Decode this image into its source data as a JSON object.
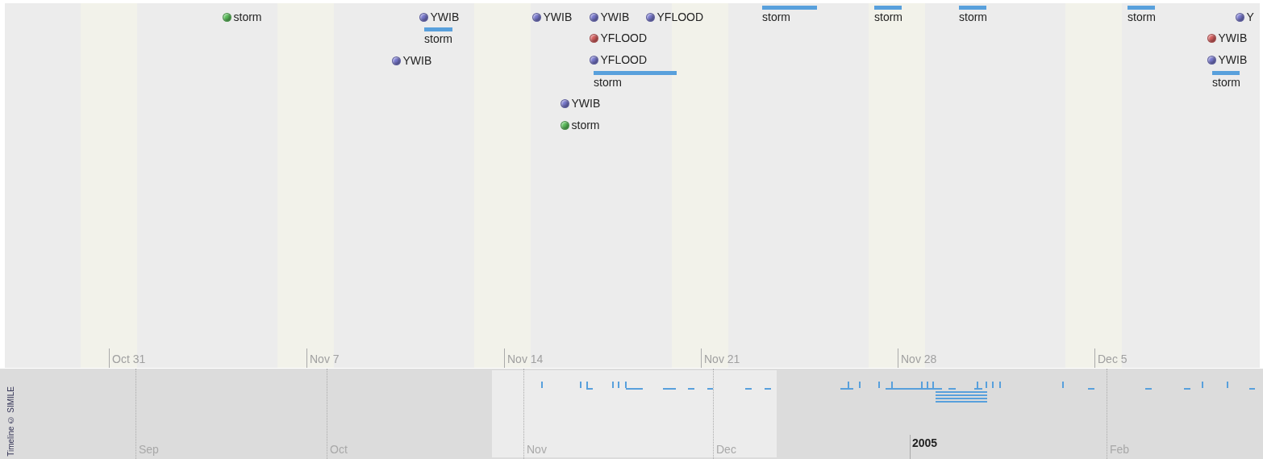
{
  "detail_band": {
    "events": [
      {
        "kind": "point",
        "label": "storm",
        "color": "#5cc05c"
      },
      {
        "kind": "point",
        "label": "YWIB",
        "color": "#7a7ad0"
      },
      {
        "kind": "duration",
        "label": "storm"
      },
      {
        "kind": "point",
        "label": "YWIB",
        "color": "#7a7ad0"
      },
      {
        "kind": "point",
        "label": "YWIB",
        "color": "#7a7ad0"
      },
      {
        "kind": "point",
        "label": "YWIB",
        "color": "#7a7ad0"
      },
      {
        "kind": "point",
        "label": "YFLOOD",
        "color": "#7a7ad0"
      },
      {
        "kind": "point",
        "label": "YFLOOD",
        "color": "#d86060"
      },
      {
        "kind": "point",
        "label": "YFLOOD",
        "color": "#7a7ad0"
      },
      {
        "kind": "duration",
        "label": "storm"
      },
      {
        "kind": "point",
        "label": "YWIB",
        "color": "#7a7ad0"
      },
      {
        "kind": "point",
        "label": "storm",
        "color": "#5cc05c"
      },
      {
        "kind": "duration",
        "label": "storm"
      },
      {
        "kind": "duration",
        "label": "storm"
      },
      {
        "kind": "duration",
        "label": "storm"
      },
      {
        "kind": "duration",
        "label": "storm"
      },
      {
        "kind": "point",
        "label": "Y",
        "color": "#7a7ad0"
      },
      {
        "kind": "point",
        "label": "YWIB",
        "color": "#d86060"
      },
      {
        "kind": "point",
        "label": "YWIB",
        "color": "#7a7ad0"
      },
      {
        "kind": "duration",
        "label": "storm"
      }
    ],
    "date_labels": [
      "Oct 31",
      "Nov 7",
      "Nov 14",
      "Nov 21",
      "Nov 28",
      "Dec 5"
    ]
  },
  "overview_band": {
    "credit": "Timeline © SIMILE",
    "labels": [
      {
        "kind": "month",
        "text": "Sep"
      },
      {
        "kind": "month",
        "text": "Oct"
      },
      {
        "kind": "month",
        "text": "Nov"
      },
      {
        "kind": "month",
        "text": "Dec"
      },
      {
        "kind": "year",
        "text": "2005"
      },
      {
        "kind": "month",
        "text": "Feb"
      }
    ]
  }
}
